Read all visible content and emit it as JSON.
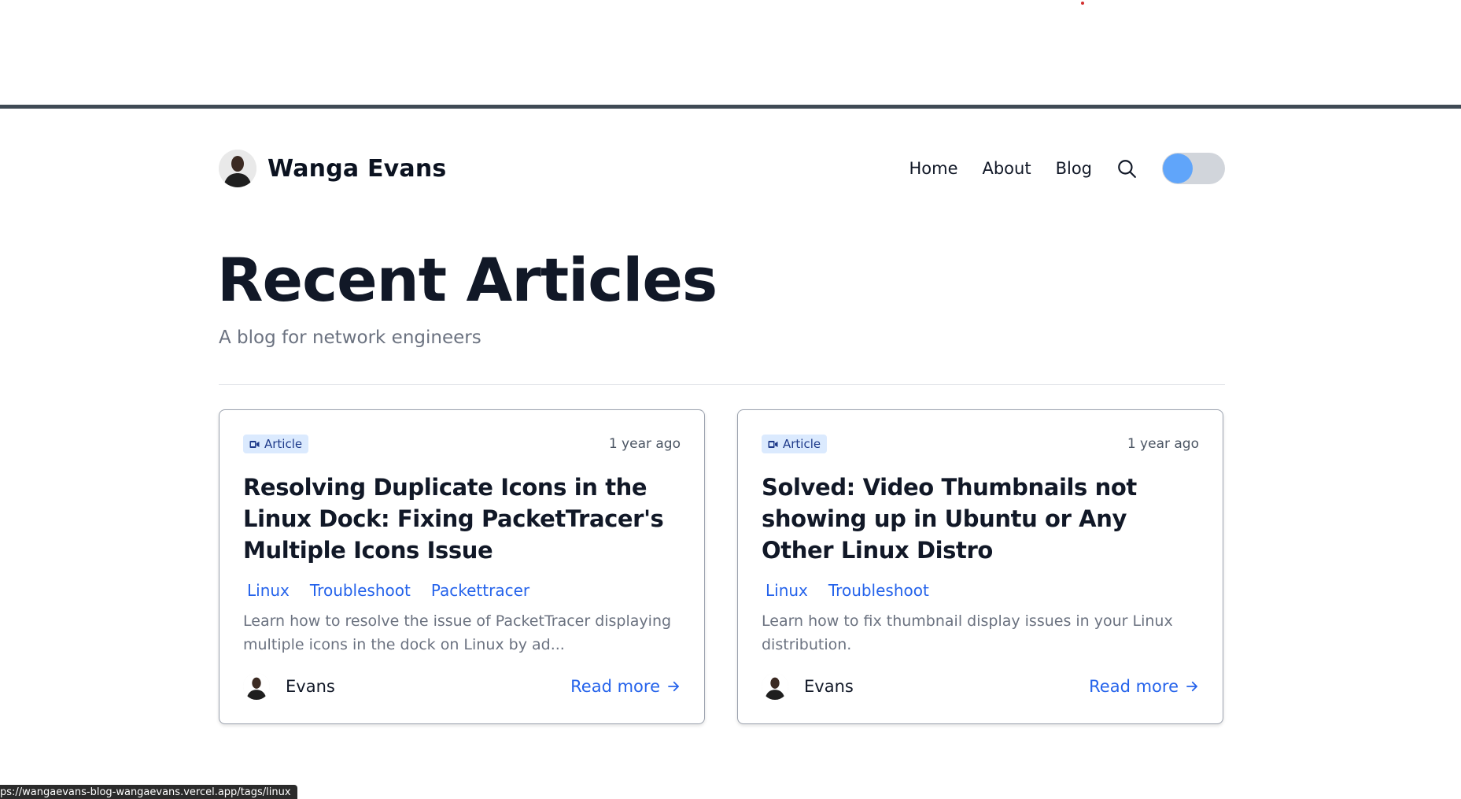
{
  "site": {
    "name": "Wanga Evans",
    "nav": {
      "home": "Home",
      "about": "About",
      "blog": "Blog"
    },
    "theme_toggle_accent": "#60a5fa"
  },
  "hero": {
    "title": "Recent Articles",
    "subtitle": "A blog for network engineers"
  },
  "articles": [
    {
      "type": "Article",
      "time": "1 year ago",
      "title": "Resolving Duplicate Icons in the Linux Dock: Fixing PacketTracer's Multiple Icons Issue",
      "tags": [
        "Linux",
        "Troubleshoot",
        "Packettracer"
      ],
      "excerpt": "Learn how to resolve the issue of PacketTracer displaying multiple icons in the dock on Linux by ad...",
      "author": "Evans",
      "read_more": "Read more"
    },
    {
      "type": "Article",
      "time": "1 year ago",
      "title": "Solved: Video Thumbnails not showing up in Ubuntu or Any Other Linux Distro",
      "tags": [
        "Linux",
        "Troubleshoot"
      ],
      "excerpt": "Learn how to fix thumbnail display issues in your Linux distribution.",
      "author": "Evans",
      "read_more": "Read more"
    }
  ],
  "status_bar": {
    "url": "ps://wangaevans-blog-wangaevans.vercel.app/tags/linux"
  },
  "colors": {
    "accent": "#2563eb",
    "badge_bg": "#dbeafe",
    "top_rule": "#3f4a55"
  }
}
